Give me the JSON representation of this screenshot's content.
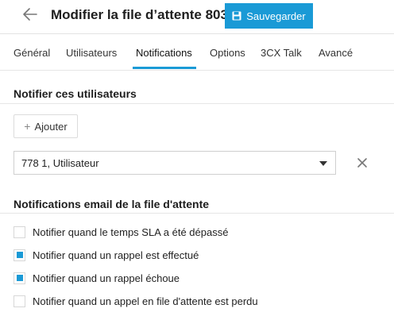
{
  "header": {
    "title": "Modifier la file d’attente 803",
    "save_label": "Sauvegarder"
  },
  "tabs": [
    {
      "label": "Général",
      "active": false
    },
    {
      "label": "Utilisateurs",
      "active": false
    },
    {
      "label": "Notifications",
      "active": true
    },
    {
      "label": "Options",
      "active": false
    },
    {
      "label": "3CX Talk",
      "active": false
    },
    {
      "label": "Avancé",
      "active": false
    }
  ],
  "notify_users": {
    "title": "Notifier ces utilisateurs",
    "add_label": "Ajouter",
    "selected_user": "778 1, Utilisateur"
  },
  "email_notifications": {
    "title": "Notifications email de la file d'attente",
    "options": [
      {
        "label": "Notifier quand le temps SLA a été dépassé",
        "checked": false
      },
      {
        "label": "Notifier quand un rappel est effectué",
        "checked": true
      },
      {
        "label": "Notifier quand un rappel échoue",
        "checked": true
      },
      {
        "label": "Notifier quand un appel en file d'attente est perdu",
        "checked": false
      }
    ]
  },
  "colors": {
    "accent": "#1a9ad6"
  }
}
